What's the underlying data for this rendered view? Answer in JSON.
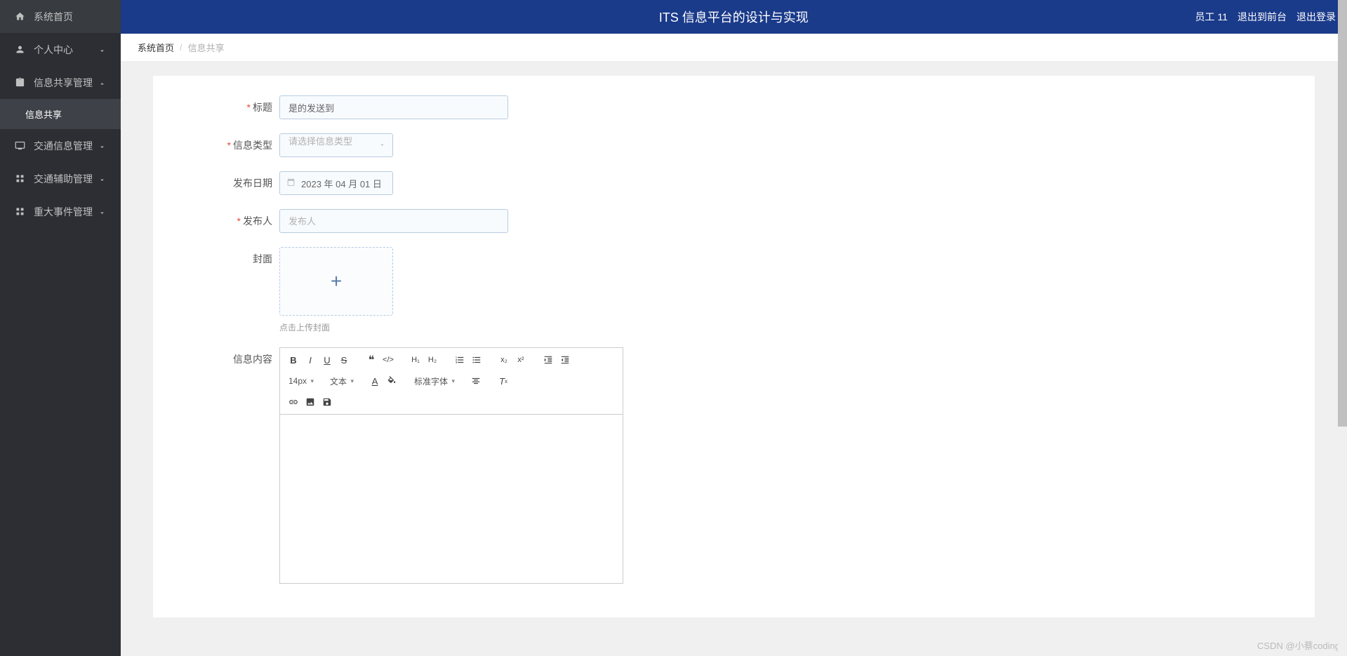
{
  "header": {
    "title": "ITS 信息平台的设计与实现",
    "user": "员工 11",
    "logout_front": "退出到前台",
    "logout": "退出登录"
  },
  "sidebar": {
    "home": "系统首页",
    "personal": "个人中心",
    "info_share_mgmt": "信息共享管理",
    "info_share": "信息共享",
    "traffic_info": "交通信息管理",
    "traffic_aux": "交通辅助管理",
    "major_events": "重大事件管理"
  },
  "breadcrumb": {
    "home": "系统首页",
    "current": "信息共享"
  },
  "form": {
    "title_label": "标题",
    "title_value": "是的发送到",
    "type_label": "信息类型",
    "type_placeholder": "请选择信息类型",
    "date_label": "发布日期",
    "date_value": "2023 年 04 月 01 日",
    "publisher_label": "发布人",
    "publisher_placeholder": "发布人",
    "cover_label": "封面",
    "cover_hint": "点击上传封面",
    "content_label": "信息内容"
  },
  "editor": {
    "font_size": "14px",
    "text_format": "文本",
    "font_family": "标准字体"
  },
  "watermark": "CSDN @小蔡coding"
}
